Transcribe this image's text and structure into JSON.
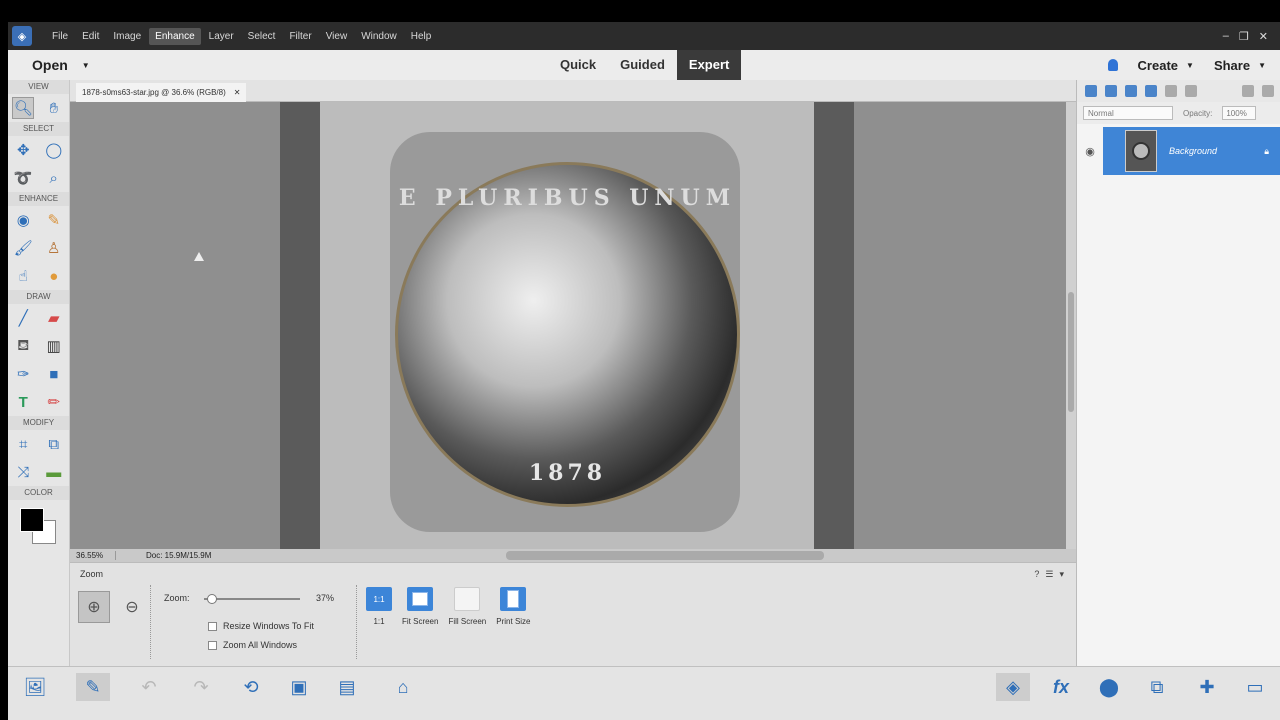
{
  "menubar": {
    "items": [
      "File",
      "Edit",
      "Image",
      "Enhance",
      "Layer",
      "Select",
      "Filter",
      "View",
      "Window",
      "Help"
    ],
    "active": "Enhance"
  },
  "modebar": {
    "open_label": "Open",
    "modes": [
      "Quick",
      "Guided",
      "Expert"
    ],
    "active_mode": "Expert",
    "create_label": "Create",
    "share_label": "Share"
  },
  "toolbox": {
    "sections": {
      "view": "VIEW",
      "select": "SELECT",
      "enhance": "ENHANCE",
      "draw": "DRAW",
      "modify": "MODIFY",
      "color": "COLOR"
    }
  },
  "document": {
    "tab_title": "1878-s0ms63-star.jpg @ 36.6% (RGB/8)",
    "coin_legend": "E PLURIBUS UNUM",
    "coin_date": "1878"
  },
  "status": {
    "zoom": "36.55%",
    "doc_size": "Doc: 15.9M/15.9M"
  },
  "options": {
    "title": "Zoom",
    "zoom_label": "Zoom:",
    "zoom_value": "37%",
    "zoom_fraction": 0.04,
    "resize_windows": "Resize Windows To Fit",
    "zoom_all": "Zoom All Windows",
    "btn_1to1": "1:1",
    "btn_fit": "Fit Screen",
    "btn_fill": "Fill Screen",
    "btn_print": "Print Size"
  },
  "layers": {
    "blend_mode": "Normal",
    "opacity_label": "Opacity:",
    "opacity_value": "100%",
    "layer_name": "Background"
  }
}
